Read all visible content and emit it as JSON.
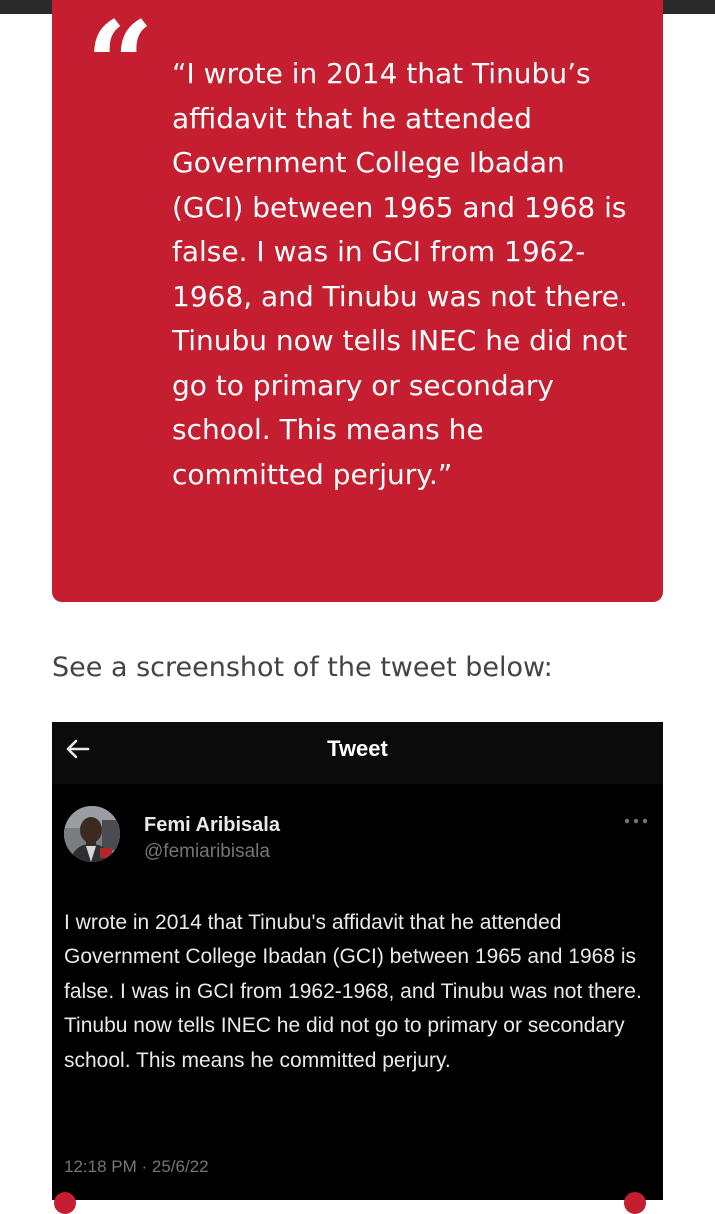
{
  "quote": {
    "mark": "“",
    "text": "“I wrote in 2014 that Tinubu’s affidavit that he attended Government College Ibadan (GCI) between 1965 and 1968 is false. I was in GCI from 1962-1968, and Tinubu was not there. Tinubu now tells INEC he did not go to primary or secondary school. This means he committed perjury.”"
  },
  "intro": "See a screenshot of the tweet below:",
  "tweet": {
    "header_title": "Tweet",
    "author_name": "Femi Aribisala",
    "author_handle": "@femiaribisala",
    "text": "I wrote in 2014 that Tinubu's affidavit that he attended Government College Ibadan (GCI) between 1965 and 1968 is false. I was in GCI from 1962-1968, and Tinubu was not there. Tinubu now tells INEC he did not go to primary or secondary school. This means he committed perjury.",
    "timestamp": "12:18 PM · 25/6/22"
  },
  "icons": {
    "back": "arrow-left-icon",
    "more": "more-dots-icon",
    "quote": "quote-mark-icon"
  },
  "colors": {
    "quote_background": "#c41e30",
    "tweet_background": "#000000",
    "tweet_text": "#e7e9ea",
    "tweet_muted": "#71767b",
    "intro_text": "#444444"
  }
}
